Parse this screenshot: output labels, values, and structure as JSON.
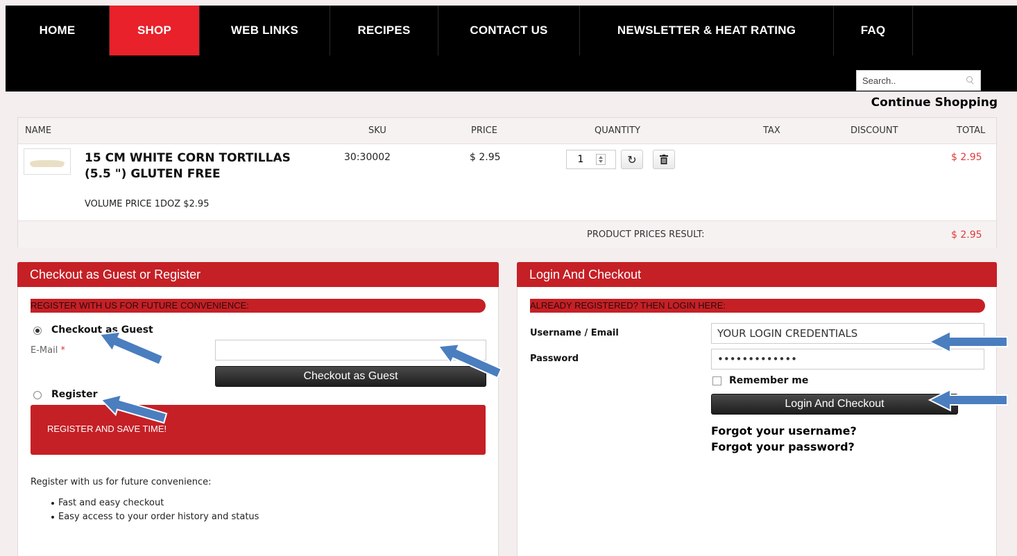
{
  "nav": {
    "items": [
      {
        "label": "HOME"
      },
      {
        "label": "SHOP"
      },
      {
        "label": "WEB LINKS"
      },
      {
        "label": "RECIPES"
      },
      {
        "label": "CONTACT US"
      },
      {
        "label": "NEWSLETTER & HEAT RATING"
      },
      {
        "label": "FAQ"
      }
    ],
    "active": "SHOP"
  },
  "search": {
    "placeholder": "Search..",
    "icon": "search-icon"
  },
  "continue_shopping": "Continue Shopping",
  "cart": {
    "columns": [
      "NAME",
      "SKU",
      "PRICE",
      "QUANTITY",
      "TAX",
      "DISCOUNT",
      "TOTAL"
    ],
    "item": {
      "name": "15 CM WHITE CORN TORTILLAS (5.5 \") GLUTEN FREE",
      "volume": "VOLUME PRICE 1DOZ $2.95",
      "sku": "30:30002",
      "price": "$ 2.95",
      "quantity": "1",
      "total": "$ 2.95"
    },
    "result_label": "PRODUCT PRICES RESULT:",
    "result_value": "$ 2.95"
  },
  "guest_panel": {
    "title": "Checkout as Guest or Register",
    "banner": "REGISTER WITH US FOR FUTURE CONVENIENCE:",
    "guest_option": "Checkout as Guest",
    "email_label": "E-Mail",
    "required_mark": "*",
    "guest_button": "Checkout as Guest",
    "register_option": "Register",
    "register_block": "REGISTER AND SAVE TIME!",
    "register_text": "Register with us for future convenience:",
    "benefits": [
      "Fast and easy checkout",
      "Easy access to your order history and status"
    ]
  },
  "login_panel": {
    "title": "Login And Checkout",
    "banner": "ALREADY REGISTERED? THEN LOGIN HERE:",
    "username_label": "Username / Email",
    "username_value": "YOUR LOGIN CREDENTIALS",
    "password_label": "Password",
    "password_value": "•••••••••••••",
    "remember_label": "Remember me",
    "login_button": "Login And Checkout",
    "forgot_username": "Forgot your username?",
    "forgot_password": "Forgot your password?"
  },
  "colors": {
    "accent_red": "#c52026",
    "nav_active": "#e8212a",
    "arrow_blue": "#4a7ebf",
    "total_red": "#e23a3a"
  }
}
